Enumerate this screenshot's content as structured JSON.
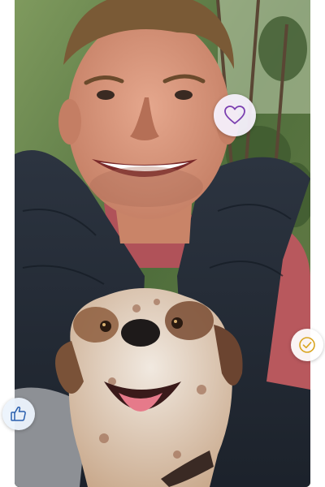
{
  "icons": {
    "favorite": "heart-icon",
    "verified": "check-circle-icon",
    "like": "thumbs-up-icon"
  },
  "colors": {
    "heart_stroke": "#7b3fb0",
    "check_stroke": "#d9a520",
    "like_stroke": "#2a5fae"
  }
}
